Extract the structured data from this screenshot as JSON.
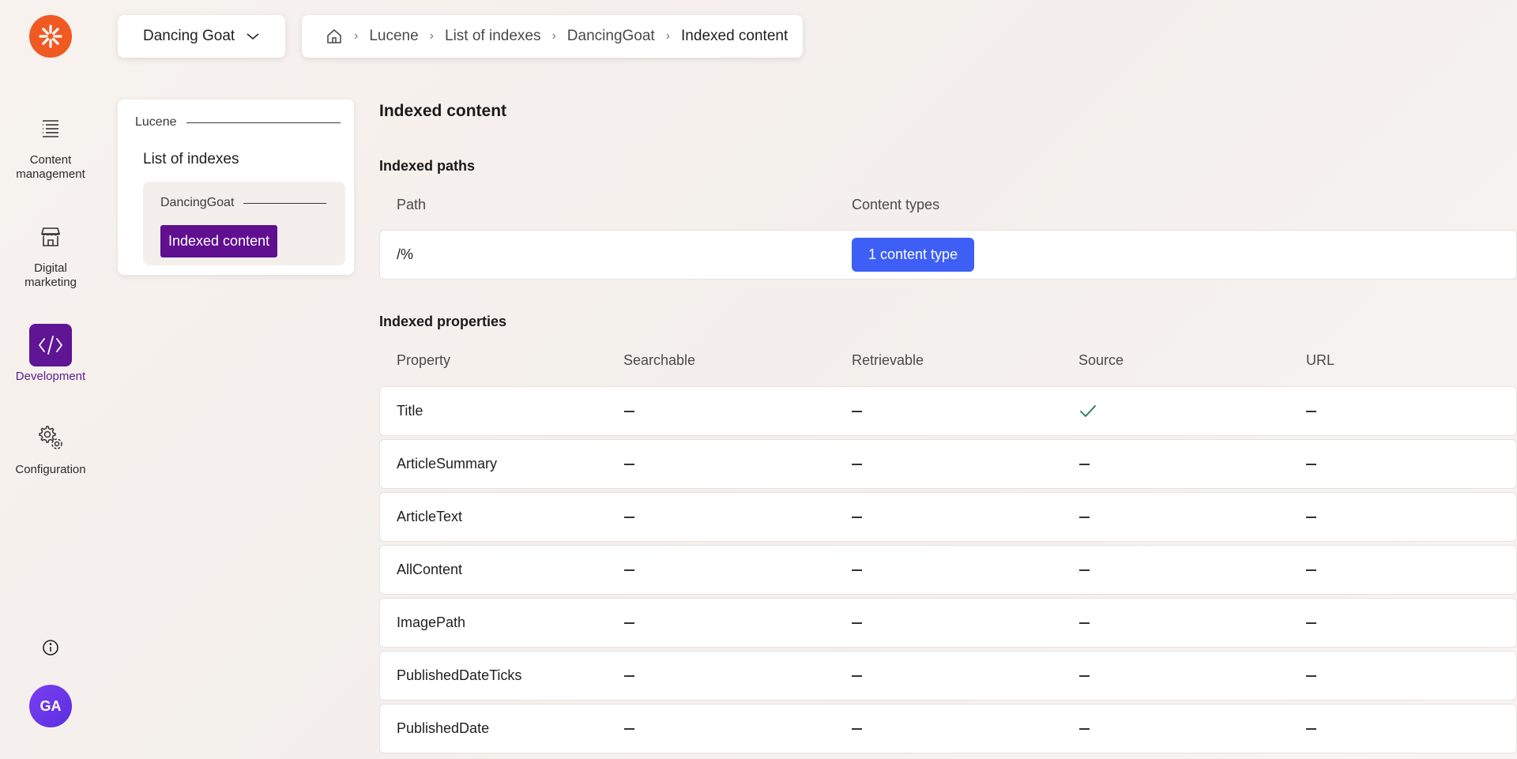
{
  "rail": {
    "logo_icon": "kentico-asterisk-icon",
    "items": [
      {
        "label": "Content management",
        "icon": "content-list-icon"
      },
      {
        "label": "Digital marketing",
        "icon": "store-icon"
      },
      {
        "label": "Development",
        "icon": "code-icon"
      },
      {
        "label": "Configuration",
        "icon": "gears-icon"
      }
    ],
    "info_icon": "info-icon",
    "avatar_initials": "GA"
  },
  "header": {
    "app_name": "Dancing Goat",
    "breadcrumb": [
      "Lucene",
      "List of indexes",
      "DancingGoat",
      "Indexed content"
    ]
  },
  "subnav": {
    "section_label": "Lucene",
    "list_link": "List of indexes",
    "group_label": "DancingGoat",
    "active_item": "Indexed content"
  },
  "main": {
    "title": "Indexed content",
    "paths": {
      "heading": "Indexed paths",
      "columns": [
        "Path",
        "Content types"
      ],
      "rows": [
        {
          "path": "/%",
          "content_types_button": "1 content type"
        }
      ]
    },
    "properties": {
      "heading": "Indexed properties",
      "columns": [
        "Property",
        "Searchable",
        "Retrievable",
        "Source",
        "URL"
      ],
      "rows": [
        {
          "name": "Title",
          "searchable": false,
          "retrievable": false,
          "source": true,
          "url": false
        },
        {
          "name": "ArticleSummary",
          "searchable": false,
          "retrievable": false,
          "source": false,
          "url": false
        },
        {
          "name": "ArticleText",
          "searchable": false,
          "retrievable": false,
          "source": false,
          "url": false
        },
        {
          "name": "AllContent",
          "searchable": false,
          "retrievable": false,
          "source": false,
          "url": false
        },
        {
          "name": "ImagePath",
          "searchable": false,
          "retrievable": false,
          "source": false,
          "url": false
        },
        {
          "name": "PublishedDateTicks",
          "searchable": false,
          "retrievable": false,
          "source": false,
          "url": false
        },
        {
          "name": "PublishedDate",
          "searchable": false,
          "retrievable": false,
          "source": false,
          "url": false
        }
      ]
    }
  },
  "colors": {
    "brand_orange": "#f05a22",
    "active_purple": "#5f0f8f",
    "button_blue": "#3d5ff6",
    "check_green": "#1d7a5c"
  }
}
